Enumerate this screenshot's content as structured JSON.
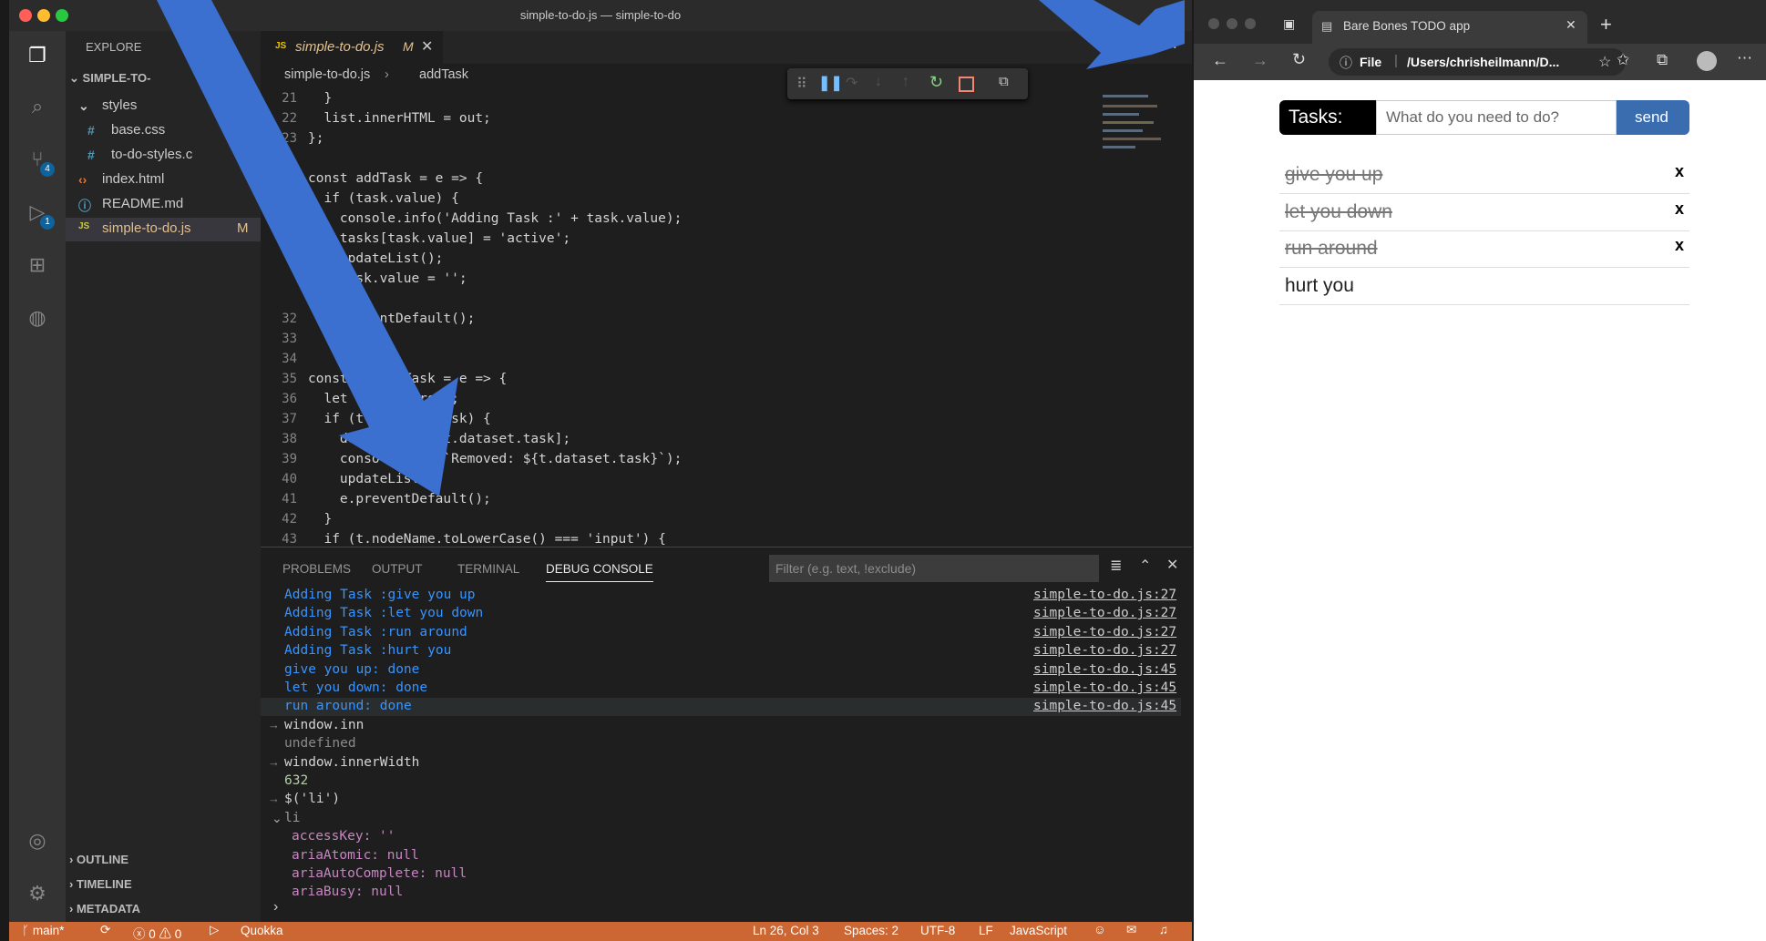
{
  "vscode": {
    "title": "simple-to-do.js — simple-to-do",
    "activity_badges": {
      "scm": "4",
      "debug": "1"
    },
    "sidebar": {
      "header": "EXPLORE",
      "folder": "SIMPLE-TO-",
      "items": [
        {
          "label": "styles",
          "kind": "folder"
        },
        {
          "label": "base.css",
          "kind": "css"
        },
        {
          "label": "to-do-styles.c",
          "kind": "css"
        },
        {
          "label": "index.html",
          "kind": "html"
        },
        {
          "label": "README.md",
          "kind": "md"
        },
        {
          "label": "simple-to-do.js",
          "kind": "js",
          "status": "M"
        }
      ],
      "sections": [
        "OUTLINE",
        "TIMELINE",
        "METADATA"
      ]
    },
    "tab": {
      "icon": "JS",
      "label": "simple-to-do.js",
      "status": "M"
    },
    "breadcrumb": {
      "file": "simple-to-do.js",
      "symbol": "addTask"
    },
    "code_lines": [
      {
        "n": "21",
        "text": "  }"
      },
      {
        "n": "22",
        "text": "  list.innerHTML = out;"
      },
      {
        "n": "23",
        "text": "};"
      },
      {
        "n": "",
        "text": ""
      },
      {
        "n": "",
        "text": "const addTask = e => {"
      },
      {
        "n": "",
        "text": "  if (task.value) {"
      },
      {
        "n": "",
        "text": "    console.info('Adding Task :' + task.value);"
      },
      {
        "n": "",
        "text": "    tasks[task.value] = 'active';"
      },
      {
        "n": "",
        "text": "    updateList();"
      },
      {
        "n": "",
        "text": "    task.value = '';"
      },
      {
        "n": "",
        "text": ""
      },
      {
        "n": "32",
        "text": "    preventDefault();"
      },
      {
        "n": "33",
        "text": ""
      },
      {
        "n": "34",
        "text": ""
      },
      {
        "n": "35",
        "text": "const removeTask = e => {"
      },
      {
        "n": "36",
        "text": "  let t = e.target;"
      },
      {
        "n": "37",
        "text": "  if (t.dataset.task) {"
      },
      {
        "n": "38",
        "text": "    delete tasks[t.dataset.task];"
      },
      {
        "n": "39",
        "text": "    console.info(`Removed: ${t.dataset.task}`);"
      },
      {
        "n": "40",
        "text": "    updateList();"
      },
      {
        "n": "41",
        "text": "    e.preventDefault();"
      },
      {
        "n": "42",
        "text": "  }"
      },
      {
        "n": "43",
        "text": "  if (t.nodeName.toLowerCase() === 'input') {"
      }
    ],
    "panel": {
      "tabs": [
        "PROBLEMS",
        "OUTPUT",
        "TERMINAL",
        "DEBUG CONSOLE"
      ],
      "active_tab": "DEBUG CONSOLE",
      "filter_placeholder": "Filter (e.g. text, !exclude)",
      "console": [
        {
          "text": "Adding Task :give you up",
          "src": "simple-to-do.js:27",
          "kind": "log"
        },
        {
          "text": "Adding Task :let you down",
          "src": "simple-to-do.js:27",
          "kind": "log"
        },
        {
          "text": "Adding Task :run around",
          "src": "simple-to-do.js:27",
          "kind": "log"
        },
        {
          "text": "Adding Task :hurt you",
          "src": "simple-to-do.js:27",
          "kind": "log"
        },
        {
          "text": "give you up: done",
          "src": "simple-to-do.js:45",
          "kind": "log"
        },
        {
          "text": "let you down: done",
          "src": "simple-to-do.js:45",
          "kind": "log"
        },
        {
          "text": "run around: done",
          "src": "simple-to-do.js:45",
          "kind": "log-sel"
        },
        {
          "text": "window.inn",
          "src": "",
          "kind": "input"
        },
        {
          "text": "undefined",
          "src": "",
          "kind": "undef"
        },
        {
          "text": "window.innerWidth",
          "src": "",
          "kind": "input"
        },
        {
          "text": "632",
          "src": "",
          "kind": "num"
        },
        {
          "text": "$('li')",
          "src": "",
          "kind": "input"
        },
        {
          "text": "li",
          "src": "",
          "kind": "tree"
        },
        {
          "text": "accessKey: ''",
          "src": "",
          "kind": "prop"
        },
        {
          "text": "ariaAtomic: null",
          "src": "",
          "kind": "prop"
        },
        {
          "text": "ariaAutoComplete: null",
          "src": "",
          "kind": "prop"
        },
        {
          "text": "ariaBusy: null",
          "src": "",
          "kind": "prop"
        }
      ]
    },
    "status": {
      "branch": "main*",
      "errors": "0",
      "warnings": "0",
      "quokka": "Quokka",
      "cursor": "Ln 26, Col 3",
      "spaces": "Spaces: 2",
      "encoding": "UTF-8",
      "eol": "LF",
      "language": "JavaScript"
    }
  },
  "browser": {
    "tab_title": "Bare Bones TODO app",
    "address_prefix": "File",
    "address": "/Users/chrisheilmann/D...",
    "todo": {
      "label": "Tasks:",
      "placeholder": "What do you need to do?",
      "send_label": "send",
      "tasks": [
        {
          "text": "give you up",
          "done": true,
          "remove": "x"
        },
        {
          "text": "let you down",
          "done": true,
          "remove": "x"
        },
        {
          "text": "run around",
          "done": true,
          "remove": "x"
        },
        {
          "text": "hurt you",
          "done": false,
          "remove": ""
        }
      ]
    }
  },
  "colors": {
    "arrow": "#3b6fd0",
    "statusbar": "#cc6633",
    "send": "#3a6db0"
  }
}
